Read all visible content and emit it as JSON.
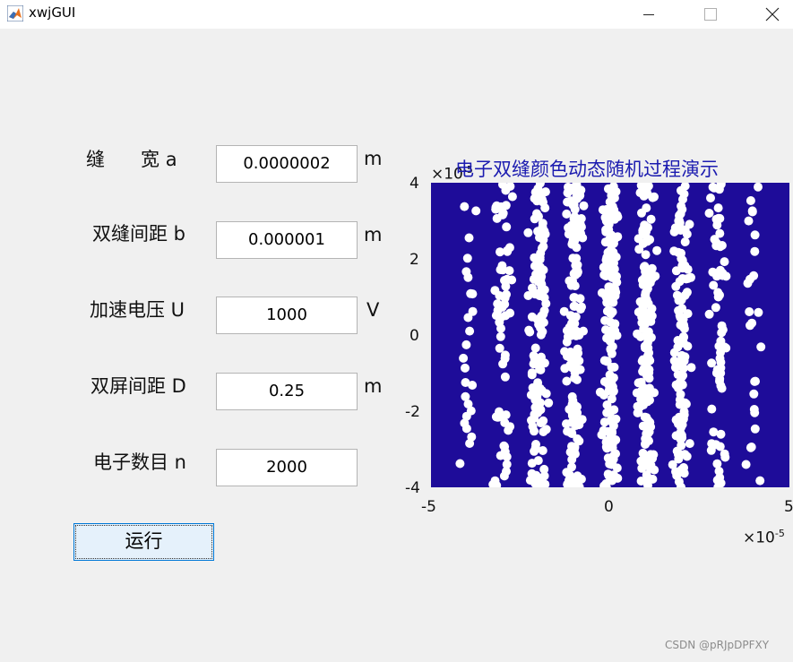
{
  "window": {
    "title": "xwjGUI"
  },
  "form": {
    "fields": [
      {
        "label": "缝      宽 a",
        "value": "0.0000002",
        "unit": "m"
      },
      {
        "label": "双缝间距 b",
        "value": "0.000001",
        "unit": "m"
      },
      {
        "label": "加速电压 U",
        "value": "1000",
        "unit": "V"
      },
      {
        "label": "双屏间距 D",
        "value": "0.25",
        "unit": "m"
      },
      {
        "label": "电子数目 n",
        "value": "2000",
        "unit": ""
      }
    ],
    "run_label": "运行"
  },
  "plot": {
    "title": "电子双缝颜色动态随机过程演示",
    "x_ticks": [
      "-5",
      "0",
      "5"
    ],
    "y_ticks": [
      "4",
      "2",
      "0",
      "-2",
      "-4"
    ],
    "x_exponent": "×10",
    "x_exponent_power": "-5",
    "y_exponent": "×10",
    "y_exponent_power": "-5",
    "background_color": "#1e0c99",
    "point_color": "#ffffff"
  },
  "chart_data": {
    "type": "scatter",
    "title": "电子双缝颜色动态随机过程演示",
    "xlim": [
      -5e-05,
      5e-05
    ],
    "ylim": [
      -4e-05,
      4e-05
    ],
    "fringe_centers_x": [
      -4e-05,
      -3e-05,
      -2e-05,
      -1e-05,
      0,
      1e-05,
      2e-05,
      3e-05,
      4e-05
    ],
    "fringe_relative_density": [
      0.15,
      0.4,
      0.75,
      0.95,
      1.0,
      0.95,
      0.75,
      0.4,
      0.15
    ],
    "electron_count": 2000
  },
  "watermark": "CSDN @pRJpDPFXY"
}
